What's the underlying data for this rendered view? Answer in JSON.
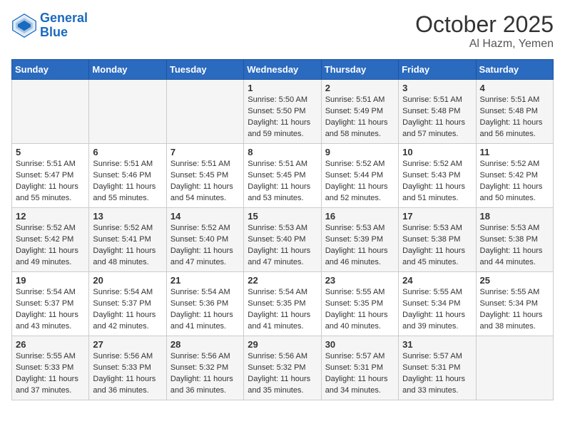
{
  "header": {
    "logo_line1": "General",
    "logo_line2": "Blue",
    "month": "October 2025",
    "location": "Al Hazm, Yemen"
  },
  "days_of_week": [
    "Sunday",
    "Monday",
    "Tuesday",
    "Wednesday",
    "Thursday",
    "Friday",
    "Saturday"
  ],
  "weeks": [
    [
      {
        "day": null,
        "sunrise": null,
        "sunset": null,
        "daylight": null
      },
      {
        "day": null,
        "sunrise": null,
        "sunset": null,
        "daylight": null
      },
      {
        "day": null,
        "sunrise": null,
        "sunset": null,
        "daylight": null
      },
      {
        "day": "1",
        "sunrise": "5:50 AM",
        "sunset": "5:50 PM",
        "daylight": "11 hours and 59 minutes."
      },
      {
        "day": "2",
        "sunrise": "5:51 AM",
        "sunset": "5:49 PM",
        "daylight": "11 hours and 58 minutes."
      },
      {
        "day": "3",
        "sunrise": "5:51 AM",
        "sunset": "5:48 PM",
        "daylight": "11 hours and 57 minutes."
      },
      {
        "day": "4",
        "sunrise": "5:51 AM",
        "sunset": "5:48 PM",
        "daylight": "11 hours and 56 minutes."
      }
    ],
    [
      {
        "day": "5",
        "sunrise": "5:51 AM",
        "sunset": "5:47 PM",
        "daylight": "11 hours and 55 minutes."
      },
      {
        "day": "6",
        "sunrise": "5:51 AM",
        "sunset": "5:46 PM",
        "daylight": "11 hours and 55 minutes."
      },
      {
        "day": "7",
        "sunrise": "5:51 AM",
        "sunset": "5:45 PM",
        "daylight": "11 hours and 54 minutes."
      },
      {
        "day": "8",
        "sunrise": "5:51 AM",
        "sunset": "5:45 PM",
        "daylight": "11 hours and 53 minutes."
      },
      {
        "day": "9",
        "sunrise": "5:52 AM",
        "sunset": "5:44 PM",
        "daylight": "11 hours and 52 minutes."
      },
      {
        "day": "10",
        "sunrise": "5:52 AM",
        "sunset": "5:43 PM",
        "daylight": "11 hours and 51 minutes."
      },
      {
        "day": "11",
        "sunrise": "5:52 AM",
        "sunset": "5:42 PM",
        "daylight": "11 hours and 50 minutes."
      }
    ],
    [
      {
        "day": "12",
        "sunrise": "5:52 AM",
        "sunset": "5:42 PM",
        "daylight": "11 hours and 49 minutes."
      },
      {
        "day": "13",
        "sunrise": "5:52 AM",
        "sunset": "5:41 PM",
        "daylight": "11 hours and 48 minutes."
      },
      {
        "day": "14",
        "sunrise": "5:52 AM",
        "sunset": "5:40 PM",
        "daylight": "11 hours and 47 minutes."
      },
      {
        "day": "15",
        "sunrise": "5:53 AM",
        "sunset": "5:40 PM",
        "daylight": "11 hours and 47 minutes."
      },
      {
        "day": "16",
        "sunrise": "5:53 AM",
        "sunset": "5:39 PM",
        "daylight": "11 hours and 46 minutes."
      },
      {
        "day": "17",
        "sunrise": "5:53 AM",
        "sunset": "5:38 PM",
        "daylight": "11 hours and 45 minutes."
      },
      {
        "day": "18",
        "sunrise": "5:53 AM",
        "sunset": "5:38 PM",
        "daylight": "11 hours and 44 minutes."
      }
    ],
    [
      {
        "day": "19",
        "sunrise": "5:54 AM",
        "sunset": "5:37 PM",
        "daylight": "11 hours and 43 minutes."
      },
      {
        "day": "20",
        "sunrise": "5:54 AM",
        "sunset": "5:37 PM",
        "daylight": "11 hours and 42 minutes."
      },
      {
        "day": "21",
        "sunrise": "5:54 AM",
        "sunset": "5:36 PM",
        "daylight": "11 hours and 41 minutes."
      },
      {
        "day": "22",
        "sunrise": "5:54 AM",
        "sunset": "5:35 PM",
        "daylight": "11 hours and 41 minutes."
      },
      {
        "day": "23",
        "sunrise": "5:55 AM",
        "sunset": "5:35 PM",
        "daylight": "11 hours and 40 minutes."
      },
      {
        "day": "24",
        "sunrise": "5:55 AM",
        "sunset": "5:34 PM",
        "daylight": "11 hours and 39 minutes."
      },
      {
        "day": "25",
        "sunrise": "5:55 AM",
        "sunset": "5:34 PM",
        "daylight": "11 hours and 38 minutes."
      }
    ],
    [
      {
        "day": "26",
        "sunrise": "5:55 AM",
        "sunset": "5:33 PM",
        "daylight": "11 hours and 37 minutes."
      },
      {
        "day": "27",
        "sunrise": "5:56 AM",
        "sunset": "5:33 PM",
        "daylight": "11 hours and 36 minutes."
      },
      {
        "day": "28",
        "sunrise": "5:56 AM",
        "sunset": "5:32 PM",
        "daylight": "11 hours and 36 minutes."
      },
      {
        "day": "29",
        "sunrise": "5:56 AM",
        "sunset": "5:32 PM",
        "daylight": "11 hours and 35 minutes."
      },
      {
        "day": "30",
        "sunrise": "5:57 AM",
        "sunset": "5:31 PM",
        "daylight": "11 hours and 34 minutes."
      },
      {
        "day": "31",
        "sunrise": "5:57 AM",
        "sunset": "5:31 PM",
        "daylight": "11 hours and 33 minutes."
      },
      {
        "day": null,
        "sunrise": null,
        "sunset": null,
        "daylight": null
      }
    ]
  ],
  "labels": {
    "sunrise_prefix": "Sunrise: ",
    "sunset_prefix": "Sunset: ",
    "daylight_prefix": "Daylight: "
  }
}
